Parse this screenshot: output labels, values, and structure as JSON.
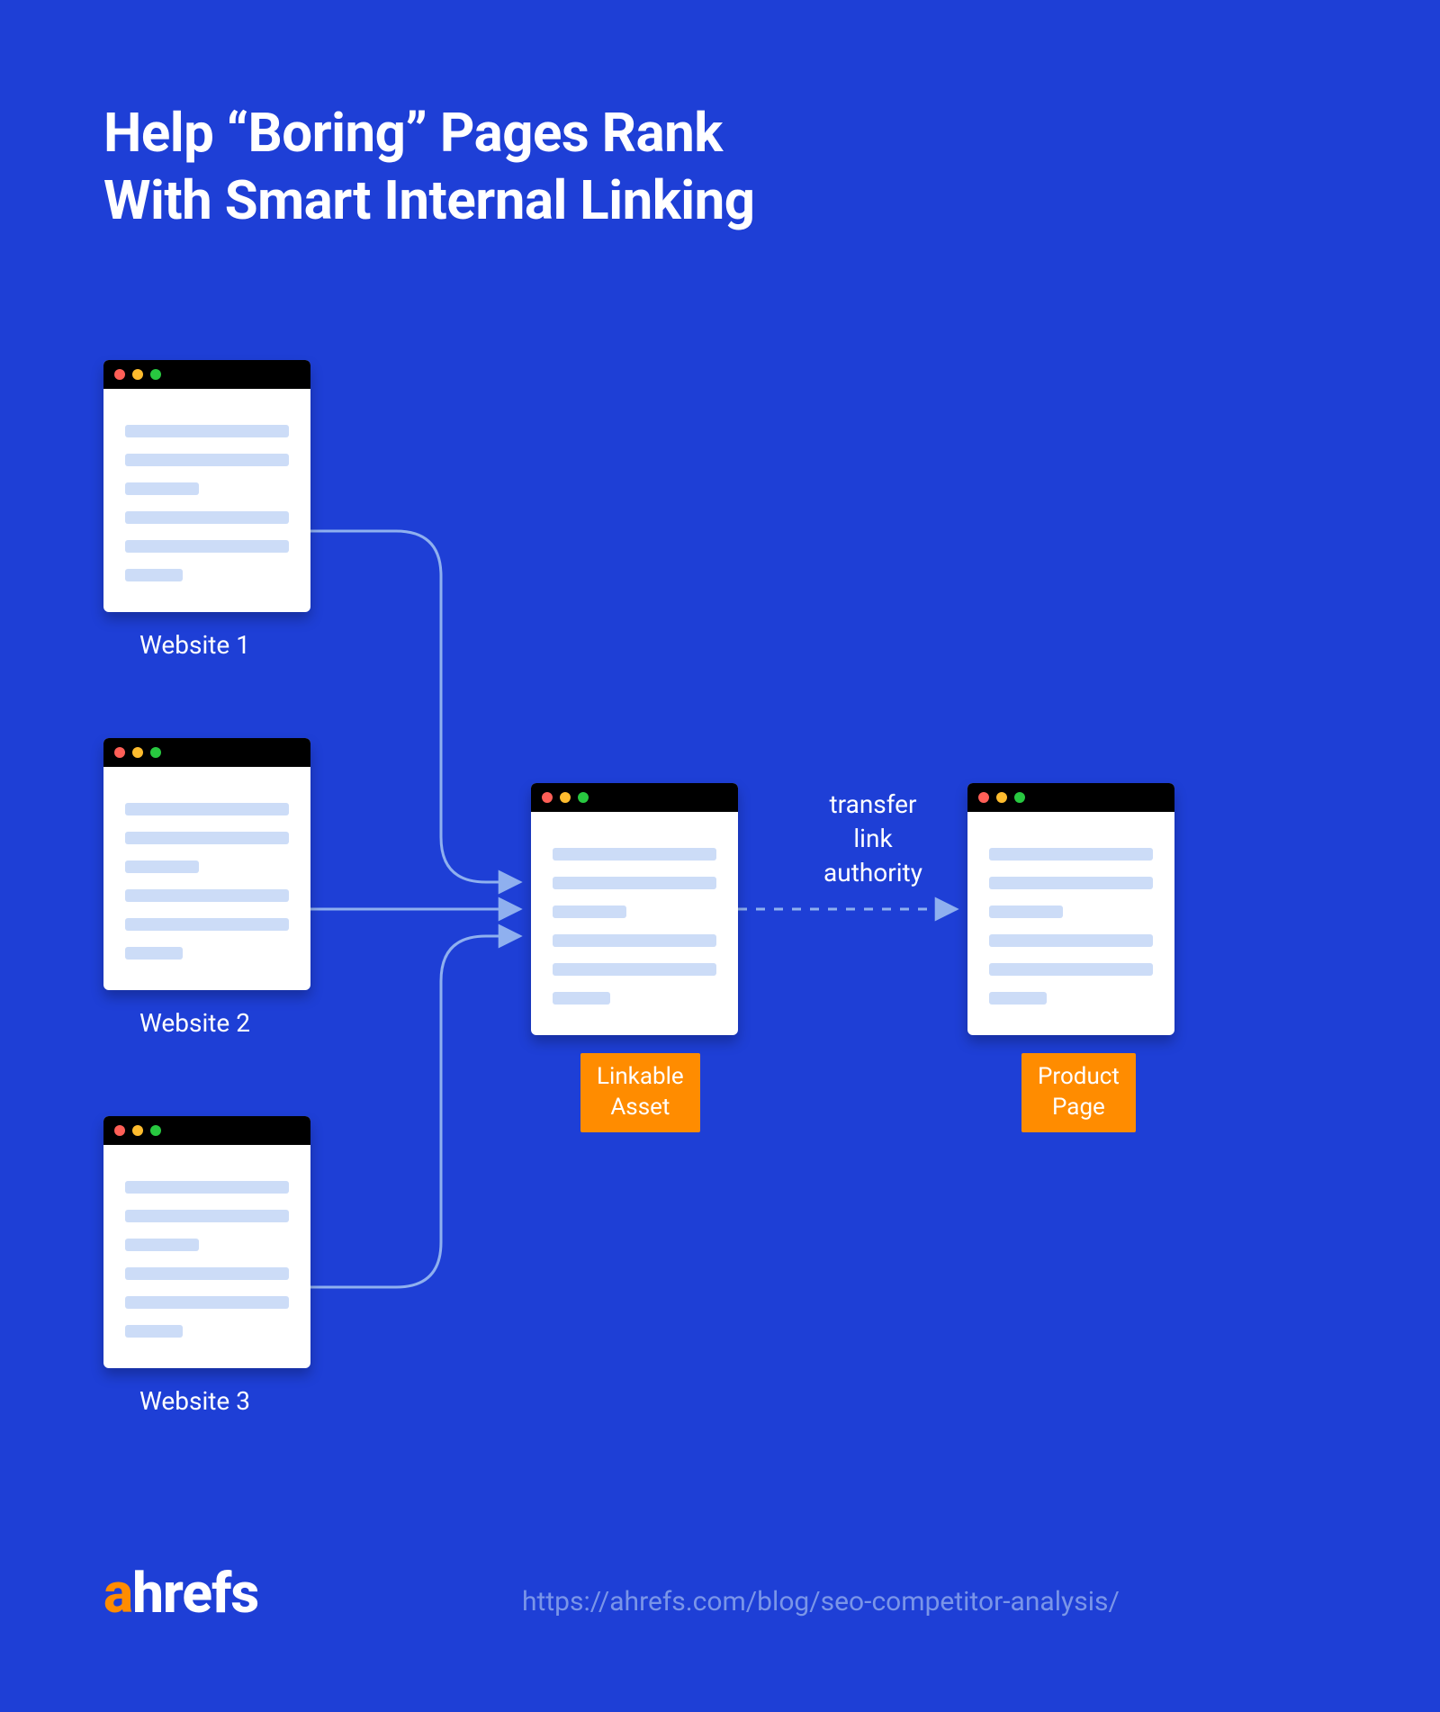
{
  "title_line1": "Help “Boring” Pages Rank",
  "title_line2": "With Smart Internal Linking",
  "sources": [
    {
      "label": "Website 1"
    },
    {
      "label": "Website 2"
    },
    {
      "label": "Website 3"
    }
  ],
  "middle_badge_line1": "Linkable",
  "middle_badge_line2": "Asset",
  "right_badge_line1": "Product",
  "right_badge_line2": "Page",
  "transfer_line1": "transfer",
  "transfer_line2": "link",
  "transfer_line3": "authority",
  "logo_prefix": "a",
  "logo_rest": "hrefs",
  "footer_url": "https://ahrefs.com/blog/seo-competitor-analysis/"
}
